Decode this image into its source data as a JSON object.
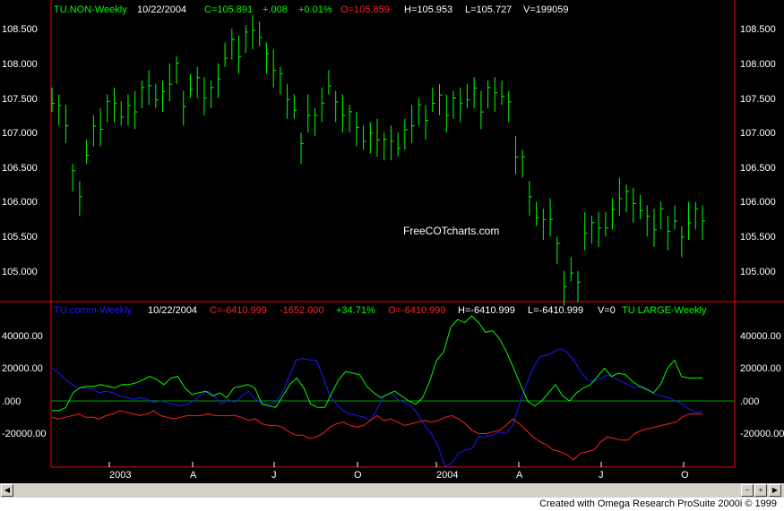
{
  "colors": {
    "background": "#000000",
    "frame": "#ff0000",
    "price_bars": "#00ff00",
    "header_white": "#ffffff",
    "header_red": "#ff2020",
    "comm": "#1a1aff",
    "large": "#00ff00",
    "small": "#ff2020",
    "zero_line": "#00a000"
  },
  "upper_header": {
    "symbol": "TU.NON-Weekly",
    "date": "10/22/2004",
    "close": "C=105.891",
    "change": "+.008",
    "pct": "+0.01%",
    "open": "O=105.859",
    "high": "H=105.953",
    "low": "L=105.727",
    "volume": "V=199059"
  },
  "lower_header": {
    "symbol": "TU.comm-Weekly",
    "date": "10/22/2004",
    "close": "C=-6410.999",
    "change": "-1652.000",
    "pct": "+34.71%",
    "open": "O=-6410.999",
    "high": "H=-6410.999",
    "low": "L=-6410.999",
    "volume": "V=0",
    "second_symbol": "TU LARGE-Weekly"
  },
  "watermark": "FreeCOTcharts.com",
  "credit": "Created with Omega Research ProSuite 2000i © 1999",
  "x_labels": [
    "2003",
    "A",
    "J",
    "O",
    "2004",
    "A",
    "J",
    "O"
  ],
  "upper_y_ticks": [
    "108.500",
    "108.000",
    "107.500",
    "107.000",
    "106.500",
    "106.000",
    "105.500",
    "105.000"
  ],
  "lower_y_ticks": [
    "40000.00",
    "20000.00",
    ".000",
    "-20000.00"
  ],
  "chart_data": [
    {
      "type": "ohlc",
      "title": "TU.NON-Weekly",
      "ylim": [
        104.5,
        108.8
      ],
      "x": [
        "2002-11-08",
        "2002-11-15",
        "2002-11-22",
        "2002-11-29",
        "2002-12-06",
        "2002-12-13",
        "2002-12-20",
        "2002-12-27",
        "2003-01-03",
        "2003-01-10",
        "2003-01-17",
        "2003-01-24",
        "2003-01-31",
        "2003-02-07",
        "2003-02-14",
        "2003-02-21",
        "2003-02-28",
        "2003-03-07",
        "2003-03-14",
        "2003-03-21",
        "2003-03-28",
        "2003-04-04",
        "2003-04-11",
        "2003-04-18",
        "2003-04-25",
        "2003-05-02",
        "2003-05-09",
        "2003-05-16",
        "2003-05-23",
        "2003-05-30",
        "2003-06-06",
        "2003-06-13",
        "2003-06-20",
        "2003-06-27",
        "2003-07-04",
        "2003-07-11",
        "2003-07-18",
        "2003-07-25",
        "2003-08-01",
        "2003-08-08",
        "2003-08-15",
        "2003-08-22",
        "2003-08-29",
        "2003-09-05",
        "2003-09-12",
        "2003-09-19",
        "2003-09-26",
        "2003-10-03",
        "2003-10-10",
        "2003-10-17",
        "2003-10-24",
        "2003-10-31",
        "2003-11-07",
        "2003-11-14",
        "2003-11-21",
        "2003-11-28",
        "2003-12-05",
        "2003-12-12",
        "2003-12-19",
        "2003-12-26",
        "2004-01-02",
        "2004-01-09",
        "2004-01-16",
        "2004-01-23",
        "2004-01-30",
        "2004-02-06",
        "2004-02-13",
        "2004-02-20",
        "2004-02-27",
        "2004-03-05",
        "2004-03-12",
        "2004-03-19",
        "2004-03-26",
        "2004-04-02",
        "2004-04-09",
        "2004-04-16",
        "2004-04-23",
        "2004-04-30",
        "2004-05-07",
        "2004-05-14",
        "2004-05-21",
        "2004-05-28",
        "2004-06-04",
        "2004-06-11",
        "2004-06-18",
        "2004-06-25",
        "2004-07-02",
        "2004-07-09",
        "2004-07-16",
        "2004-07-23",
        "2004-07-30",
        "2004-08-06",
        "2004-08-13",
        "2004-08-20",
        "2004-08-27",
        "2004-09-03",
        "2004-09-10",
        "2004-09-17",
        "2004-09-24",
        "2004-10-01",
        "2004-10-08",
        "2004-10-15",
        "2004-10-22"
      ],
      "high": [
        107.65,
        107.55,
        107.4,
        106.55,
        106.3,
        106.9,
        107.25,
        107.35,
        107.55,
        107.65,
        107.45,
        107.55,
        107.6,
        107.75,
        107.9,
        107.7,
        107.75,
        108.0,
        108.1,
        107.6,
        107.85,
        107.95,
        107.8,
        107.75,
        108.0,
        108.3,
        108.5,
        108.4,
        108.55,
        108.7,
        108.6,
        108.3,
        108.2,
        107.95,
        107.7,
        107.55,
        107.0,
        107.55,
        107.35,
        107.65,
        107.9,
        107.6,
        107.55,
        107.4,
        107.3,
        107.1,
        107.15,
        107.2,
        107.0,
        107.1,
        107.0,
        107.2,
        107.4,
        107.5,
        107.4,
        107.65,
        107.7,
        107.55,
        107.6,
        107.65,
        107.7,
        107.8,
        107.6,
        107.75,
        107.8,
        107.75,
        107.6,
        106.95,
        106.75,
        106.3,
        106.0,
        105.9,
        106.05,
        105.5,
        105.0,
        105.2,
        105.0,
        105.85,
        105.8,
        105.85,
        105.85,
        106.05,
        106.35,
        106.25,
        106.2,
        106.1,
        105.95,
        105.9,
        106.0,
        105.8,
        105.95,
        105.65,
        106.0,
        106.0,
        105.95
      ]
    },
    {
      "type": "line",
      "ylim": [
        -40000,
        55000
      ],
      "x_range": [
        "2002-11-08",
        "2004-10-22"
      ],
      "series": [
        {
          "name": "TU.comm-Weekly",
          "values": [
            20000,
            17000,
            13000,
            10000,
            8000,
            8000,
            7000,
            5000,
            6000,
            5000,
            3000,
            2000,
            1000,
            2000,
            1000,
            -1000,
            0,
            -1000,
            -2000,
            -3000,
            -2000,
            0,
            4000,
            6000,
            3000,
            -2000,
            1000,
            -1000,
            3000,
            6000,
            1000,
            -1000,
            -2000,
            -1000,
            5000,
            15000,
            25000,
            26000,
            25000,
            25000,
            15000,
            3000,
            -2000,
            -6000,
            -8000,
            -9000,
            -10000,
            -12000,
            -5000,
            3000,
            5000,
            1000,
            -1000,
            -3000,
            -8000,
            -15000,
            -20000,
            -28000,
            -40000,
            -38000,
            -32000,
            -30000,
            -29000,
            -22000,
            -22000,
            -21000,
            -19000,
            -20000,
            -15000,
            -2000,
            10000,
            20000,
            27000,
            28000,
            30000,
            32000,
            30000,
            25000,
            18000,
            13000,
            12000,
            14000,
            16000,
            14000,
            12000,
            10000,
            8000,
            9000,
            7000,
            4000,
            3000,
            2000,
            0,
            -2000,
            -5000,
            -7000,
            -6410.999
          ]
        },
        {
          "name": "TU LARGE-Weekly",
          "values": [
            -6000,
            -6000,
            -4000,
            5000,
            8000,
            9000,
            9000,
            10000,
            9000,
            8000,
            10000,
            10000,
            11000,
            13000,
            15000,
            13000,
            10000,
            14000,
            15000,
            8000,
            4000,
            5000,
            6000,
            3000,
            5000,
            2000,
            8000,
            9000,
            10000,
            8000,
            -2000,
            -3000,
            -4000,
            3000,
            10000,
            14000,
            8000,
            -2000,
            -4000,
            -4000,
            5000,
            13000,
            18000,
            17000,
            16000,
            9000,
            5000,
            2000,
            4000,
            6000,
            3000,
            0,
            -2000,
            2000,
            12000,
            25000,
            30000,
            45000,
            50000,
            48000,
            52000,
            48000,
            42000,
            43000,
            38000,
            30000,
            20000,
            10000,
            0,
            -3000,
            0,
            5000,
            10000,
            3000,
            0,
            5000,
            8000,
            10000,
            15000,
            20000,
            15000,
            17000,
            16000,
            12000,
            9000,
            7000,
            5000,
            10000,
            20000,
            25000,
            15000,
            14000,
            14000,
            14000
          ]
        },
        {
          "name": "",
          "values": [
            -10000,
            -11000,
            -10000,
            -9000,
            -8000,
            -10000,
            -10000,
            -11000,
            -9000,
            -8000,
            -6000,
            -7000,
            -8000,
            -9000,
            -8000,
            -6000,
            -9000,
            -10000,
            -11000,
            -10000,
            -9000,
            -9000,
            -9000,
            -8000,
            -9000,
            -9000,
            -9000,
            -9000,
            -10000,
            -12000,
            -11000,
            -14000,
            -15000,
            -15000,
            -16000,
            -19000,
            -21000,
            -21000,
            -23000,
            -22000,
            -20000,
            -16000,
            -14000,
            -13000,
            -15000,
            -16000,
            -15000,
            -12000,
            -9000,
            -12000,
            -11000,
            -13000,
            -15000,
            -14000,
            -13000,
            -12000,
            -13000,
            -12000,
            -10000,
            -9000,
            -11000,
            -14000,
            -18000,
            -20000,
            -20000,
            -19000,
            -18000,
            -15000,
            -11000,
            -14000,
            -18000,
            -22000,
            -25000,
            -27000,
            -30000,
            -31000,
            -33000,
            -36000,
            -32000,
            -31000,
            -30000,
            -25000,
            -22000,
            -23000,
            -24000,
            -24000,
            -20000,
            -18000,
            -17000,
            -16000,
            -15000,
            -14000,
            -13000,
            -10000,
            -8000,
            -8000,
            -8000
          ]
        }
      ]
    }
  ]
}
